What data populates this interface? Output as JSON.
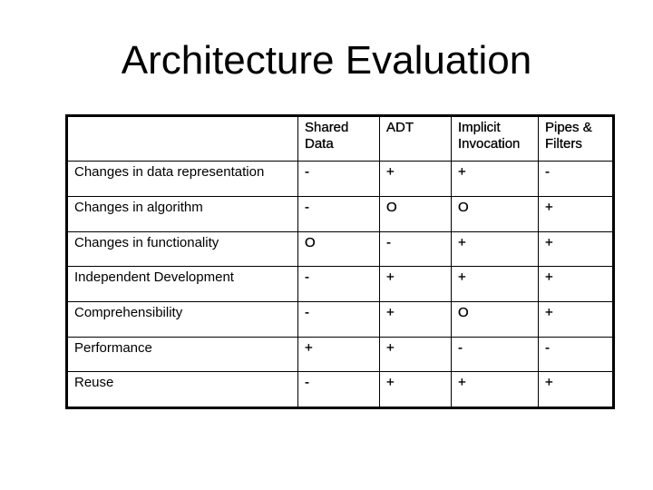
{
  "title": "Architecture Evaluation",
  "table": {
    "columns": [
      {
        "line1": "Shared",
        "line2": "Data"
      },
      {
        "line1": "ADT",
        "line2": ""
      },
      {
        "line1": "Implicit",
        "line2": "Invocation"
      },
      {
        "line1": "Pipes &",
        "line2": "Filters"
      }
    ],
    "rows": [
      {
        "criterion": "Changes in data representation",
        "values": [
          "-",
          "+",
          "+",
          "-"
        ]
      },
      {
        "criterion": "Changes in algorithm",
        "values": [
          "-",
          "O",
          "O",
          "+"
        ]
      },
      {
        "criterion": "Changes in functionality",
        "values": [
          "O",
          "-",
          "+",
          "+"
        ]
      },
      {
        "criterion": "Independent Development",
        "values": [
          "-",
          "+",
          "+",
          "+"
        ]
      },
      {
        "criterion": "Comprehensibility",
        "values": [
          "-",
          "+",
          "O",
          "+"
        ]
      },
      {
        "criterion": "Performance",
        "values": [
          "+",
          "+",
          "-",
          "-"
        ]
      },
      {
        "criterion": "Reuse",
        "values": [
          "-",
          "+",
          "+",
          "+"
        ]
      }
    ]
  }
}
